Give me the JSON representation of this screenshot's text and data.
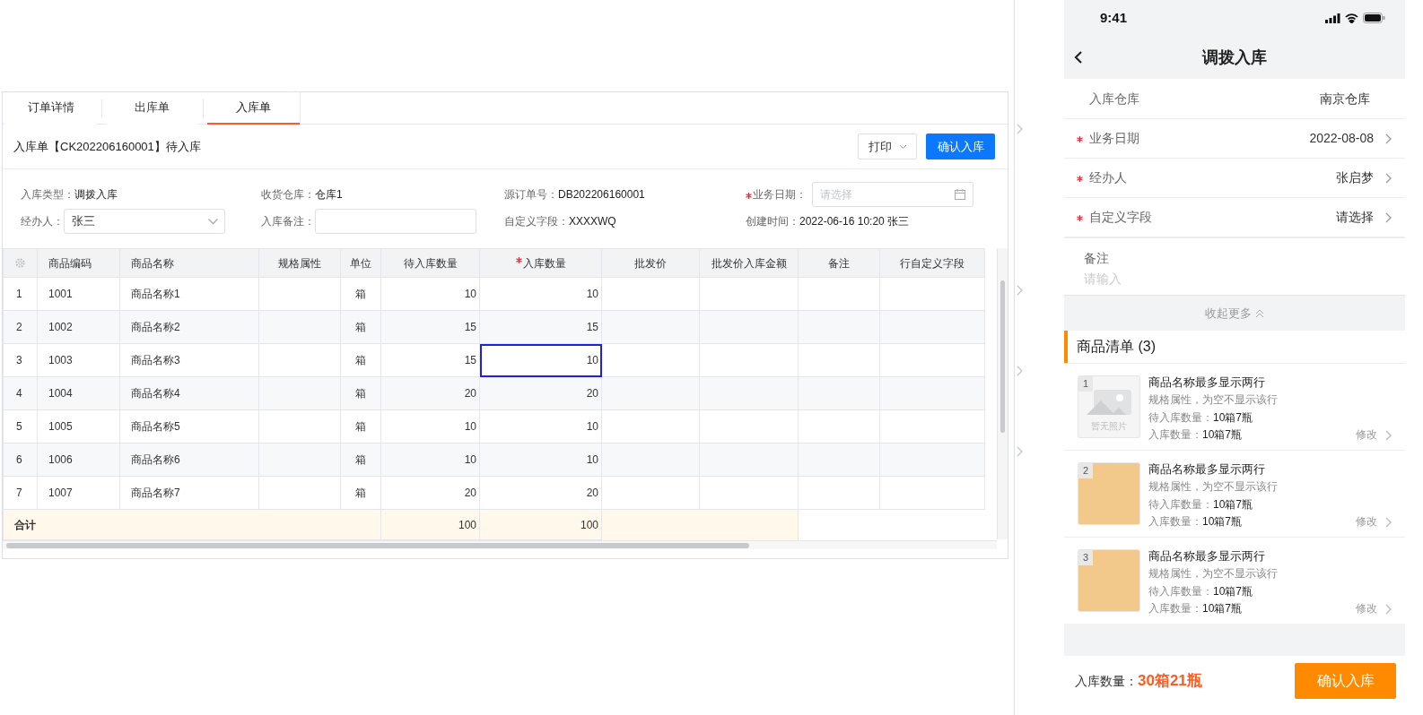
{
  "tabs": [
    {
      "label": "订单详情",
      "selected": false
    },
    {
      "label": "出库单",
      "selected": false
    },
    {
      "label": "入库单",
      "selected": true
    }
  ],
  "order": {
    "title": "入库单【CK202206160001】待入库",
    "buttons": [
      {
        "kind": "dropdown",
        "label": "打印"
      },
      {
        "kind": "primary",
        "label": "确认入库"
      }
    ]
  },
  "form": [
    {
      "kind": "text",
      "label": "入库类型：",
      "value": "调拨入库",
      "required": false
    },
    {
      "kind": "text",
      "label": "收货仓库：",
      "value": "仓库1",
      "required": false
    },
    {
      "kind": "text",
      "label": "源订单号：",
      "value": "DB202206160001",
      "required": false
    },
    {
      "kind": "date",
      "label": "业务日期：",
      "placeholder": "请选择",
      "required": true
    },
    {
      "kind": "select",
      "label": "经办人：",
      "value": "张三",
      "required": false
    },
    {
      "kind": "input",
      "label": "入库备注：",
      "required": false
    },
    {
      "kind": "text",
      "label": "自定义字段：",
      "value": "XXXXWQ",
      "required": false
    },
    {
      "kind": "text",
      "label": "创建时间：",
      "value": "2022-06-16 10:20 张三",
      "required": false
    }
  ],
  "table": {
    "columns": [
      {
        "label": "商品编码",
        "required": false
      },
      {
        "label": "商品名称",
        "required": false
      },
      {
        "label": "规格属性",
        "required": false
      },
      {
        "label": "单位",
        "required": false
      },
      {
        "label": "待入库数量",
        "required": false
      },
      {
        "label": "入库数量",
        "required": true
      },
      {
        "label": "批发价",
        "required": false
      },
      {
        "label": "批发价入库金额",
        "required": false
      },
      {
        "label": "备注",
        "required": false
      },
      {
        "label": "行自定义字段",
        "required": false
      }
    ],
    "rows": [
      {
        "index": "1",
        "code": "1001",
        "name": "商品名称1",
        "unit": "箱",
        "pending": "10",
        "qty": "10",
        "editing": false
      },
      {
        "index": "2",
        "code": "1002",
        "name": "商品名称2",
        "unit": "箱",
        "pending": "15",
        "qty": "15",
        "editing": false
      },
      {
        "index": "3",
        "code": "1003",
        "name": "商品名称3",
        "unit": "箱",
        "pending": "15",
        "qty": "10",
        "editing": true
      },
      {
        "index": "4",
        "code": "1004",
        "name": "商品名称4",
        "unit": "箱",
        "pending": "20",
        "qty": "20",
        "editing": false
      },
      {
        "index": "5",
        "code": "1005",
        "name": "商品名称5",
        "unit": "箱",
        "pending": "10",
        "qty": "10",
        "editing": false
      },
      {
        "index": "6",
        "code": "1006",
        "name": "商品名称6",
        "unit": "箱",
        "pending": "10",
        "qty": "10",
        "editing": false
      },
      {
        "index": "7",
        "code": "1007",
        "name": "商品名称7",
        "unit": "箱",
        "pending": "20",
        "qty": "20",
        "editing": false
      }
    ],
    "total": {
      "label": "合计",
      "pending": "100",
      "qty": "100"
    }
  },
  "mobile": {
    "time": "9:41",
    "title": "调拨入库",
    "fields": [
      {
        "label": "入库仓库",
        "value": "南京仓库",
        "required": false,
        "link": false
      },
      {
        "label": "业务日期",
        "value": "2022-08-08",
        "required": true,
        "link": true
      },
      {
        "label": "经办人",
        "value": "张启梦",
        "required": true,
        "link": true
      },
      {
        "label": "自定义字段",
        "value": "请选择",
        "required": true,
        "link": true
      }
    ],
    "remark": {
      "label": "备注",
      "placeholder": "请输入"
    },
    "collapse": "收起更多",
    "section": "商品清单 (3)",
    "products": [
      {
        "index": "1",
        "name": "商品名称最多显示两行",
        "spec": "规格属性，为空不显示该行",
        "pending_label": "待入库数量：",
        "pending": "10箱7瓶",
        "qty_label": "入库数量：",
        "qty": "10箱7瓶",
        "edit": "修改",
        "has_photo": false,
        "no_photo_text": "暂无照片"
      },
      {
        "index": "2",
        "name": "商品名称最多显示两行",
        "spec": "规格属性，为空不显示该行",
        "pending_label": "待入库数量：",
        "pending": "10箱7瓶",
        "qty_label": "入库数量：",
        "qty": "10箱7瓶",
        "edit": "修改",
        "has_photo": true
      },
      {
        "index": "3",
        "name": "商品名称最多显示两行",
        "spec": "规格属性，为空不显示该行",
        "pending_label": "待入库数量：",
        "pending": "10箱7瓶",
        "qty_label": "入库数量：",
        "qty": "10箱7瓶",
        "edit": "修改",
        "has_photo": true
      }
    ],
    "footer": {
      "label": "入库数量：",
      "value": "30箱21瓶",
      "button": "确认入库"
    }
  }
}
